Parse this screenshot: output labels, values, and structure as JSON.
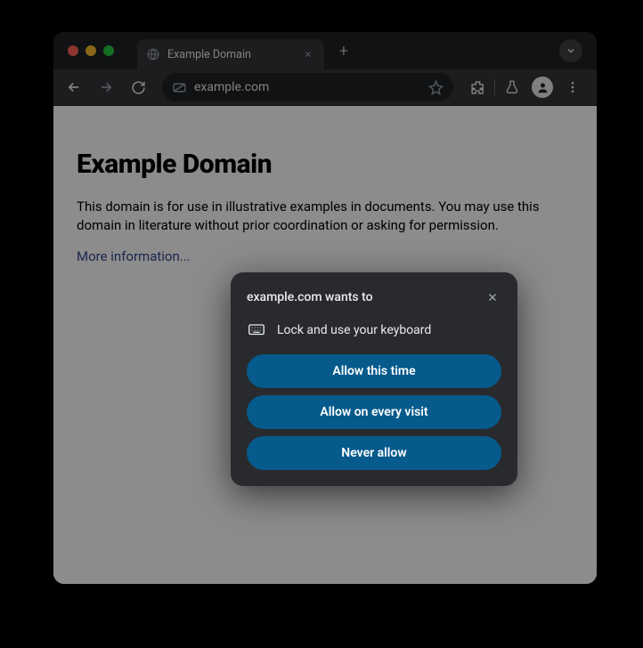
{
  "tab": {
    "title": "Example Domain"
  },
  "toolbar": {
    "url": "example.com"
  },
  "page": {
    "heading": "Example Domain",
    "body": "This domain is for use in illustrative examples in documents. You may use this domain in literature without prior coordination or asking for permission.",
    "link": "More information..."
  },
  "dialog": {
    "title": "example.com wants to",
    "permission": "Lock and use your keyboard",
    "buttons": {
      "allow_once": "Allow this time",
      "allow_every": "Allow on every visit",
      "never": "Never allow"
    }
  }
}
